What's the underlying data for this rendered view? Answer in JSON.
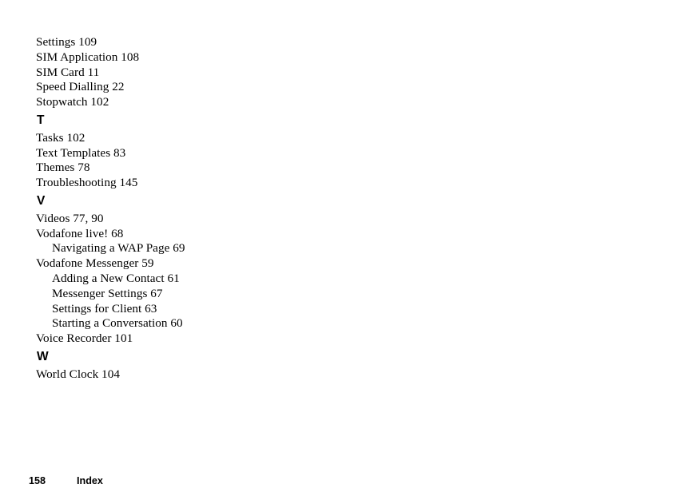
{
  "document": {
    "type": "index",
    "footer": {
      "page_number": "158",
      "label": "Index"
    }
  },
  "index": {
    "sections": [
      {
        "heading": null,
        "entries": [
          {
            "text": "Settings 109",
            "level": 0
          },
          {
            "text": "SIM Application 108",
            "level": 0
          },
          {
            "text": "SIM Card 11",
            "level": 0
          },
          {
            "text": "Speed Dialling 22",
            "level": 0
          },
          {
            "text": "Stopwatch 102",
            "level": 0
          }
        ]
      },
      {
        "heading": "T",
        "entries": [
          {
            "text": "Tasks 102",
            "level": 0
          },
          {
            "text": "Text Templates 83",
            "level": 0
          },
          {
            "text": "Themes 78",
            "level": 0
          },
          {
            "text": "Troubleshooting 145",
            "level": 0
          }
        ]
      },
      {
        "heading": "V",
        "entries": [
          {
            "text": "Videos 77, 90",
            "level": 0
          },
          {
            "text": "Vodafone live! 68",
            "level": 0
          },
          {
            "text": "Navigating a WAP Page 69",
            "level": 1
          },
          {
            "text": "Vodafone Messenger 59",
            "level": 0
          },
          {
            "text": "Adding a New Contact 61",
            "level": 1
          },
          {
            "text": "Messenger Settings 67",
            "level": 1
          },
          {
            "text": "Settings for Client 63",
            "level": 1
          },
          {
            "text": "Starting a Conversation 60",
            "level": 1
          },
          {
            "text": "Voice Recorder 101",
            "level": 0
          }
        ]
      },
      {
        "heading": "W",
        "entries": [
          {
            "text": "World Clock 104",
            "level": 0
          }
        ]
      }
    ]
  }
}
